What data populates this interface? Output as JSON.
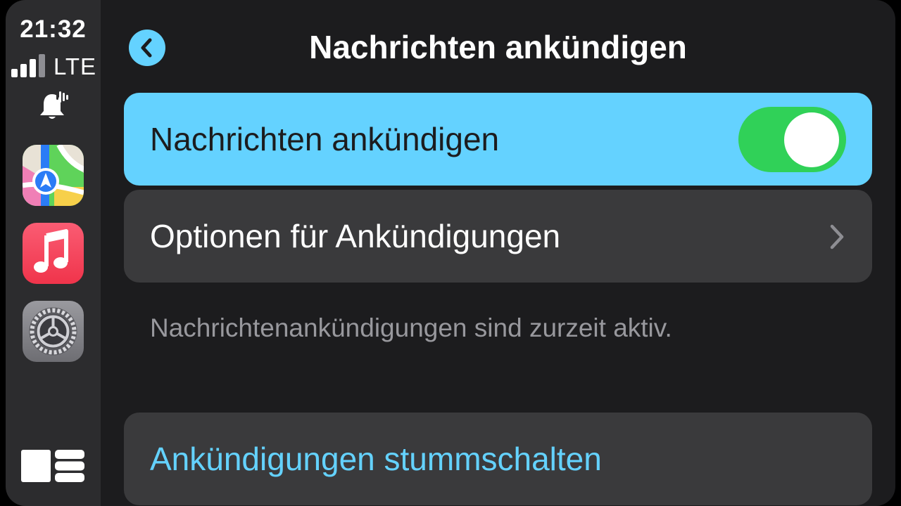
{
  "status_bar": {
    "time": "21:32",
    "network": "LTE",
    "signal_bars": 4,
    "signal_bars_filled": 3
  },
  "sidebar": {
    "apps": [
      {
        "name": "Maps",
        "icon": "maps-icon"
      },
      {
        "name": "Music",
        "icon": "music-icon"
      },
      {
        "name": "Settings",
        "icon": "settings-icon"
      }
    ],
    "announce_indicator_icon": "bell-announce-icon",
    "dashboard_icon": "dashboard-icon"
  },
  "header": {
    "title": "Nachrichten ankündigen",
    "back_icon": "chevron-left-icon"
  },
  "settings": {
    "announce_row": {
      "label": "Nachrichten ankündigen",
      "toggle_on": true
    },
    "options_row": {
      "label": "Optionen für Ankündigungen",
      "icon": "chevron-right-icon"
    },
    "footer_note": "Nachrichtenankündigungen sind zurzeit aktiv.",
    "mute_row": {
      "label": "Ankündigungen stummschalten"
    }
  },
  "colors": {
    "accent": "#64d2ff",
    "toggle_on": "#30d158",
    "sidebar_bg": "#2c2c2e",
    "main_bg": "#1c1c1e",
    "row_bg": "#3a3a3c",
    "secondary_text": "#98989d"
  }
}
